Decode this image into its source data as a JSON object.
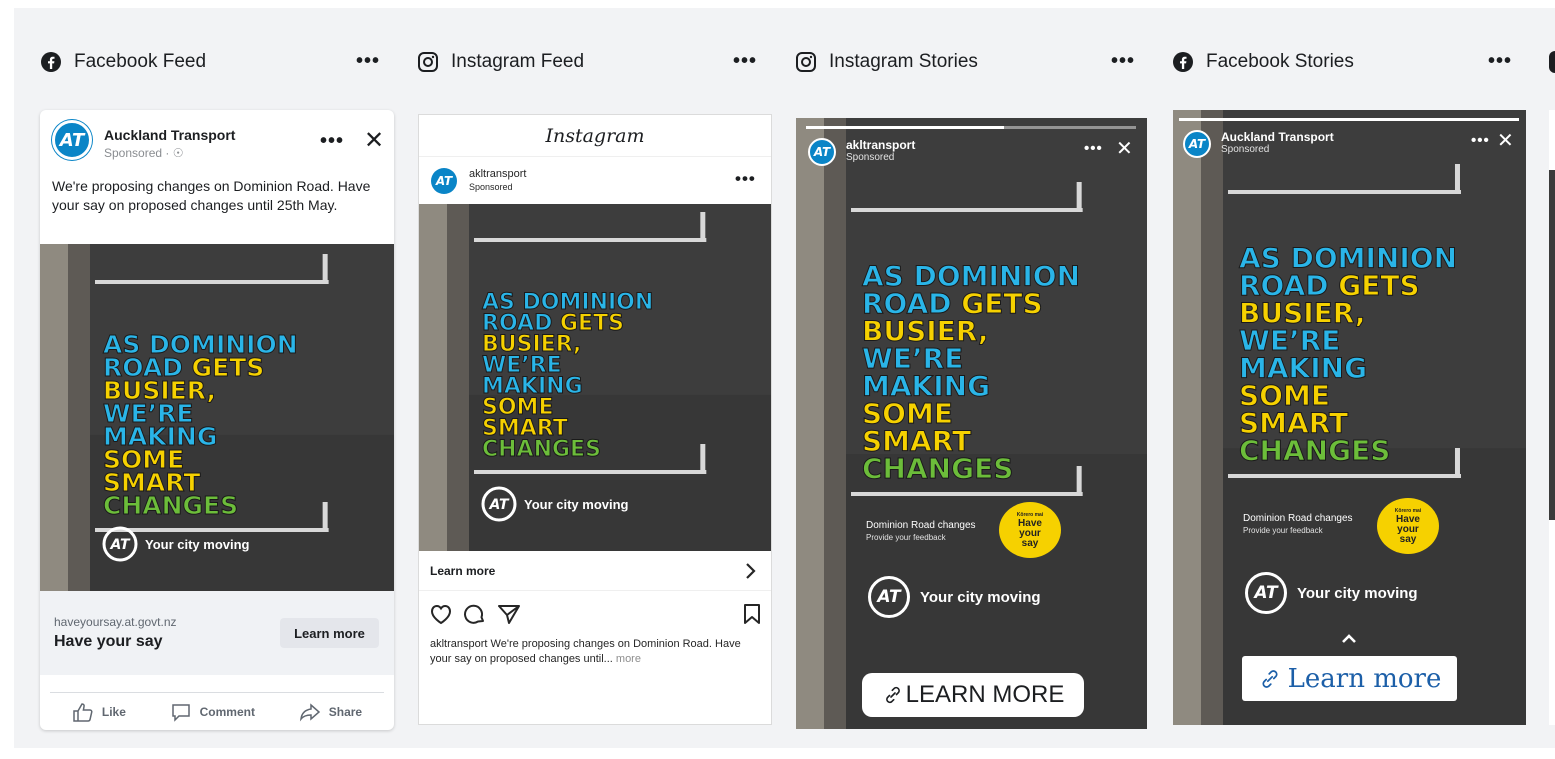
{
  "columns": [
    {
      "label": "Facebook Feed",
      "icon": "facebook-icon",
      "more": "•••"
    },
    {
      "label": "Instagram Feed",
      "icon": "instagram-icon",
      "more": "•••"
    },
    {
      "label": "Instagram Stories",
      "icon": "instagram-icon",
      "more": "•••"
    },
    {
      "label": "Facebook Stories",
      "icon": "facebook-icon",
      "more": "•••"
    }
  ],
  "brand": {
    "logo_text": "AT",
    "blue": "#0a85c7",
    "yellow": "#f6d100",
    "green": "#6cbd3a",
    "cyan": "#2ab5e8"
  },
  "poster": {
    "lines": [
      {
        "text": "AS DOMINION",
        "color": "cyan"
      },
      {
        "text": "ROAD",
        "color": "cyan",
        "tail": " GETS",
        "tail_color": "yellow"
      },
      {
        "text": "BUSIER,",
        "color": "yellow"
      },
      {
        "text": "WE’RE",
        "color": "cyan"
      },
      {
        "text": "MAKING",
        "color": "cyan"
      },
      {
        "text": "SOME",
        "color": "yellow"
      },
      {
        "text": "SMART",
        "color": "yellow"
      },
      {
        "text": "CHANGES",
        "color": "green"
      }
    ],
    "tagline": "Your city moving"
  },
  "fb_feed": {
    "page_name": "Auckland Transport",
    "sponsored": "Sponsored · ☉",
    "more": "•••",
    "close": "✕",
    "body": "We're proposing changes on Dominion Road. Have your say on proposed changes until 25th May.",
    "domain": "haveyoursay.at.govt.nz",
    "headline": "Have your say",
    "cta": "Learn more",
    "actions": {
      "like": "Like",
      "comment": "Comment",
      "share": "Share"
    }
  },
  "ig_feed": {
    "app_title": "Instagram",
    "handle": "akltransport",
    "sponsored": "Sponsored",
    "more": "•••",
    "cta": "Learn more",
    "chevron": "›",
    "caption_handle": "akltransport",
    "caption": "We're proposing changes on Dominion Road. Have your say on proposed changes until...",
    "caption_more": "more"
  },
  "ig_story": {
    "handle": "akltransport",
    "sponsored": "Sponsored",
    "more": "•••",
    "close": "✕",
    "feedback_title": "Dominion Road changes",
    "feedback_sub": "Provide your feedback",
    "bubble_small": "Kōrero mai",
    "bubble_big": "Have your say",
    "cta": "LEARN MORE",
    "progress": 0.6
  },
  "fb_story": {
    "page_name": "Auckland Transport",
    "sponsored": "Sponsored",
    "more": "•••",
    "close": "✕",
    "feedback_title": "Dominion Road changes",
    "feedback_sub": "Provide your feedback",
    "bubble_small": "Kōrero mai",
    "bubble_big": "Have your say",
    "swipe_icon": "chevron-up-icon",
    "cta": "Learn more",
    "progress": 1.0
  }
}
